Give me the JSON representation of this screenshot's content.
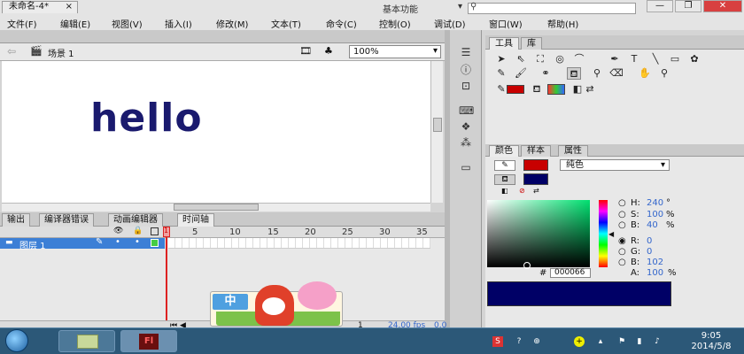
{
  "app": {
    "logo": "Fl",
    "workspace": "基本功能",
    "window_controls": [
      "—",
      "❐",
      "✕"
    ]
  },
  "menu": [
    "文件(F)",
    "编辑(E)",
    "视图(V)",
    "插入(I)",
    "修改(M)",
    "文本(T)",
    "命令(C)",
    "控制(O)",
    "调试(D)",
    "窗口(W)",
    "帮助(H)"
  ],
  "document": {
    "tab_label": "未命名-4*",
    "close": "×",
    "scene_label": "场景 1",
    "zoom": "100%",
    "stage_text": "hello"
  },
  "bottom_tabs": [
    "输出",
    "编译器错误",
    "动画编辑器",
    "时间轴"
  ],
  "timeline": {
    "layer_name": "图层 1",
    "frame_numbers": [
      "5",
      "10",
      "15",
      "20",
      "25",
      "30",
      "35"
    ],
    "current_frame": "1",
    "status_frame": "1",
    "fps": "24.00 fps",
    "elapsed": "0.0"
  },
  "right_panel": {
    "tabs": [
      "工具",
      "库"
    ],
    "color_tabs": [
      "颜色",
      "样本",
      "属性"
    ],
    "fill_type": "纯色",
    "hsb": {
      "h_label": "H:",
      "h_value": "240",
      "h_unit": "°",
      "s_label": "S:",
      "s_value": "100",
      "s_unit": "%",
      "b_label": "B:",
      "b_value": "40",
      "b_unit": "%"
    },
    "rgb": {
      "r_label": "R:",
      "r_value": "0",
      "g_label": "G:",
      "g_value": "0",
      "b_label": "B:",
      "b_value": "102",
      "a_label": "A:",
      "a_value": "100",
      "a_unit": "%"
    },
    "hex_prefix": "#",
    "hex": "000066",
    "stroke_color": "#c80000",
    "fill_color": "#000066"
  },
  "ime": {
    "label": "中"
  },
  "taskbar": {
    "time": "9:05",
    "date": "2014/5/8"
  }
}
